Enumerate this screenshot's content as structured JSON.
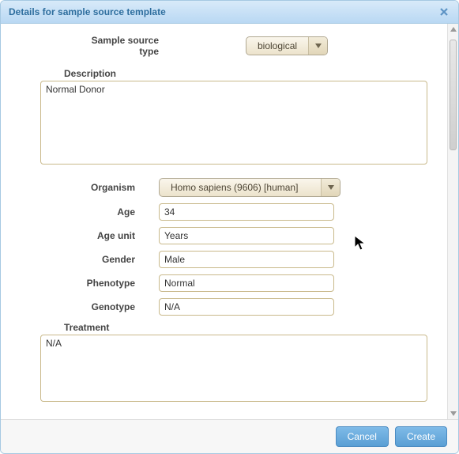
{
  "dialog": {
    "title": "Details for sample source template"
  },
  "fields": {
    "sample_source_type": {
      "label": "Sample source type",
      "value": "biological"
    },
    "description": {
      "label": "Description",
      "value": "Normal Donor"
    },
    "organism": {
      "label": "Organism",
      "value": "Homo sapiens (9606) [human]"
    },
    "age": {
      "label": "Age",
      "value": "34"
    },
    "age_unit": {
      "label": "Age unit",
      "value": "Years"
    },
    "gender": {
      "label": "Gender",
      "value": "Male"
    },
    "phenotype": {
      "label": "Phenotype",
      "value": "Normal"
    },
    "genotype": {
      "label": "Genotype",
      "value": "N/A"
    },
    "treatment": {
      "label": "Treatment",
      "value": "N/A"
    }
  },
  "buttons": {
    "cancel": "Cancel",
    "create": "Create"
  }
}
